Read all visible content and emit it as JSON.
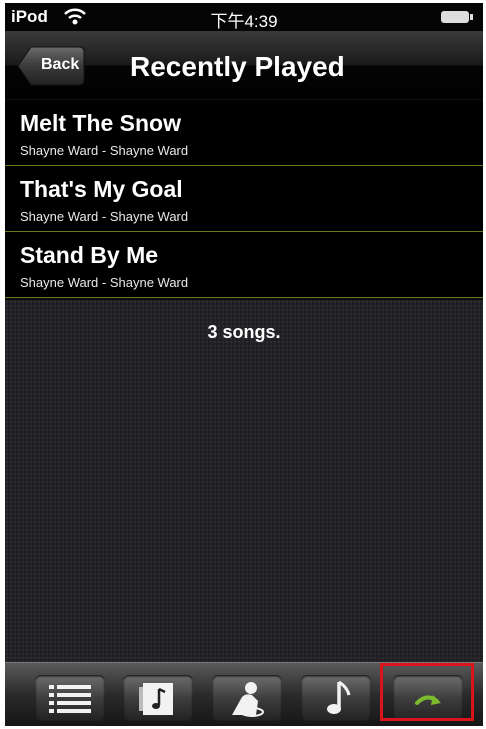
{
  "status": {
    "carrier": "iPod",
    "time": "下午4:39"
  },
  "nav": {
    "back_label": "Back",
    "title": "Recently Played"
  },
  "songs": [
    {
      "title": "Melt The Snow",
      "subtitle": "Shayne Ward - Shayne Ward"
    },
    {
      "title": "That's My Goal",
      "subtitle": "Shayne Ward - Shayne Ward"
    },
    {
      "title": "Stand By Me",
      "subtitle": "Shayne Ward - Shayne Ward"
    }
  ],
  "song_count": "3 songs.",
  "toolbar": {
    "buttons": [
      {
        "icon": "list-icon"
      },
      {
        "icon": "album-icon"
      },
      {
        "icon": "artist-icon"
      },
      {
        "icon": "music-note-icon"
      },
      {
        "icon": "recently-played-icon",
        "highlighted": true
      }
    ]
  },
  "colors": {
    "accent_divider": "#6b7a1e",
    "highlight_border": "#d9141b",
    "icon_green": "#7dbb2e"
  }
}
